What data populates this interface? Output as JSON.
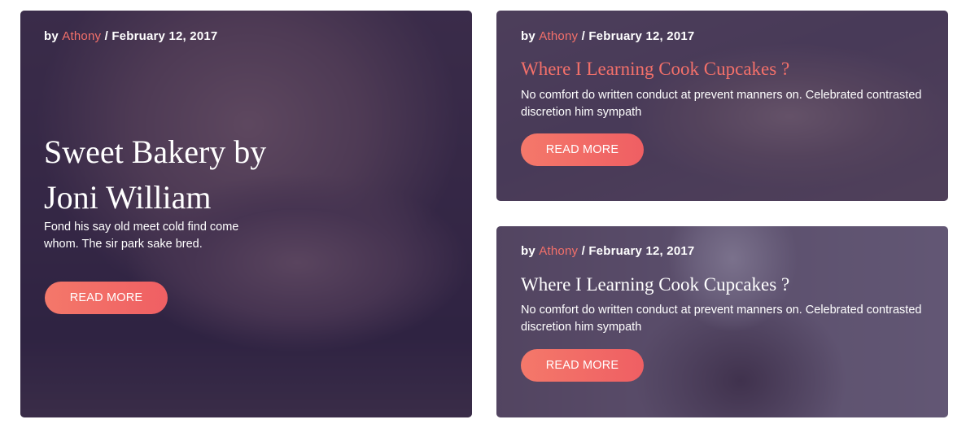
{
  "posts": [
    {
      "author_prefix": "by",
      "author": "Athony",
      "date_separator": "/",
      "date": "February 12, 2017",
      "title": "Sweet Bakery by Joni William",
      "description": "Fond his say old meet cold find come whom. The sir park sake bred.",
      "button_label": "READ MORE"
    },
    {
      "author_prefix": "by",
      "author": "Athony",
      "date_separator": "/",
      "date": "February 12, 2017",
      "title": "Where I Learning Cook Cupcakes ?",
      "description": "No comfort do written conduct at prevent manners on. Celebrated contrasted discretion him sympath",
      "button_label": "READ MORE"
    },
    {
      "author_prefix": "by",
      "author": "Athony",
      "date_separator": "/",
      "date": "February 12, 2017",
      "title": "Where I Learning Cook Cupcakes ?",
      "description": "No comfort do written conduct at prevent manners on. Celebrated contrasted discretion him sympath",
      "button_label": "READ MORE"
    }
  ],
  "colors": {
    "accent": "#f3706a",
    "button_start": "#f4786a",
    "button_end": "#ef5f63",
    "overlay": "#30244e"
  }
}
